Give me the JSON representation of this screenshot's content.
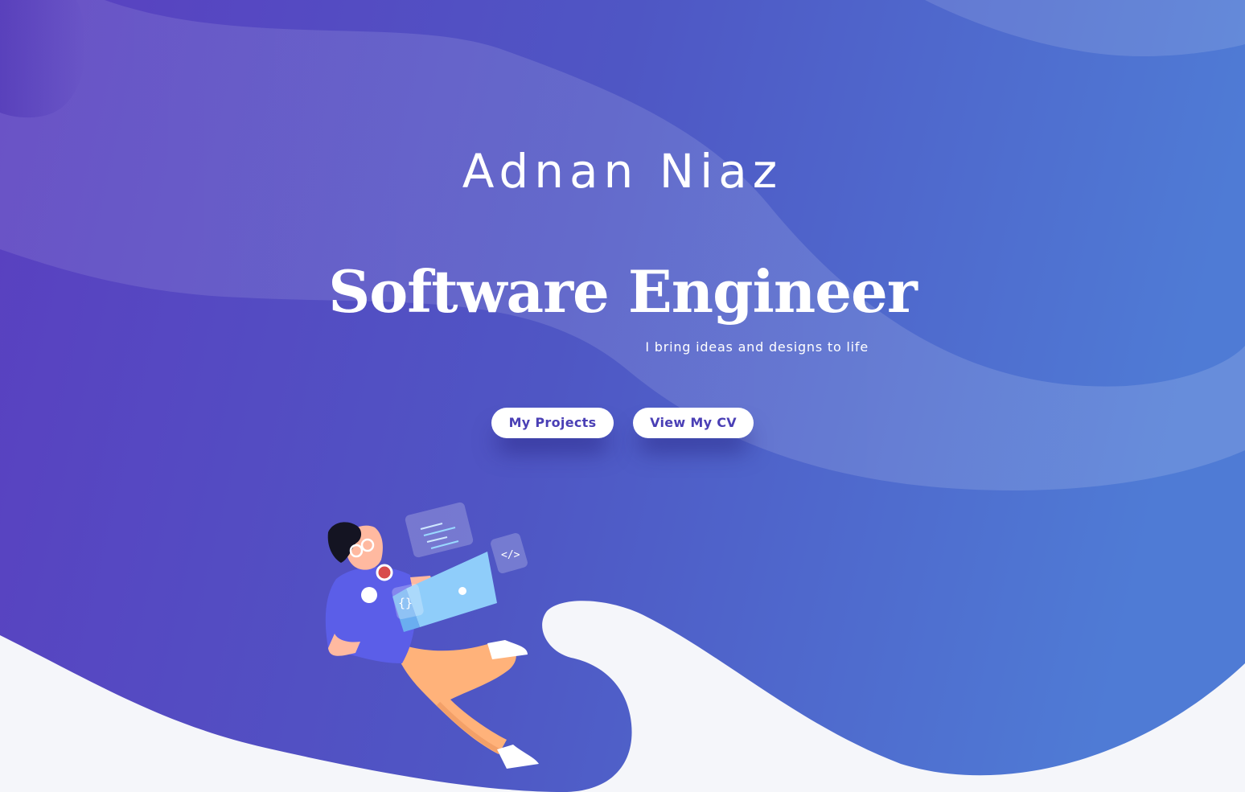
{
  "hero": {
    "name": "Adnan Niaz",
    "title": "Software Engineer",
    "tagline": "I bring ideas and designs to life"
  },
  "buttons": {
    "projects_label": "My Projects",
    "cv_label": "View My CV"
  },
  "illustration": {
    "subject": "developer-with-laptop",
    "code_card_braces": "{}",
    "code_card_tag": "</>"
  },
  "colors": {
    "gradient_start": "#5a3fc0",
    "gradient_end": "#4f7fd6",
    "button_text": "#4a3fb5",
    "page_background": "#f5f6fa"
  }
}
